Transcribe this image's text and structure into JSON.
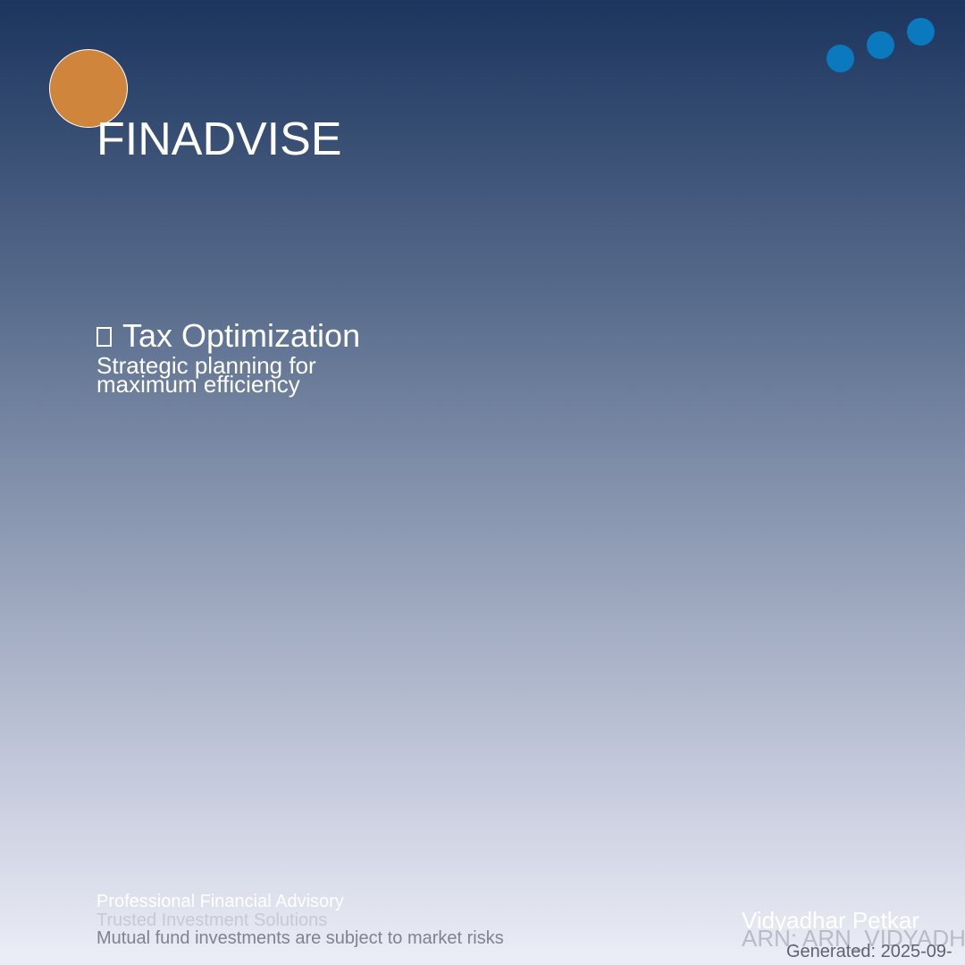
{
  "brand": {
    "name": "FINADVISE",
    "logo_color": "#d0853d",
    "dot_color": "#0a79be"
  },
  "feature": {
    "icon": "document-icon",
    "title": "Tax Optimization",
    "description": "Strategic planning for maximum efficiency"
  },
  "footer": {
    "tagline": "Professional Financial Advisory",
    "subtitle": "Trusted Investment Solutions",
    "disclaimer": "Mutual fund investments are subject to market risks"
  },
  "advisor": {
    "name": "Vidyadhar Petkar",
    "arn": "ARN: ARN_VIDYADH",
    "generated": "Generated: 2025-09-"
  }
}
